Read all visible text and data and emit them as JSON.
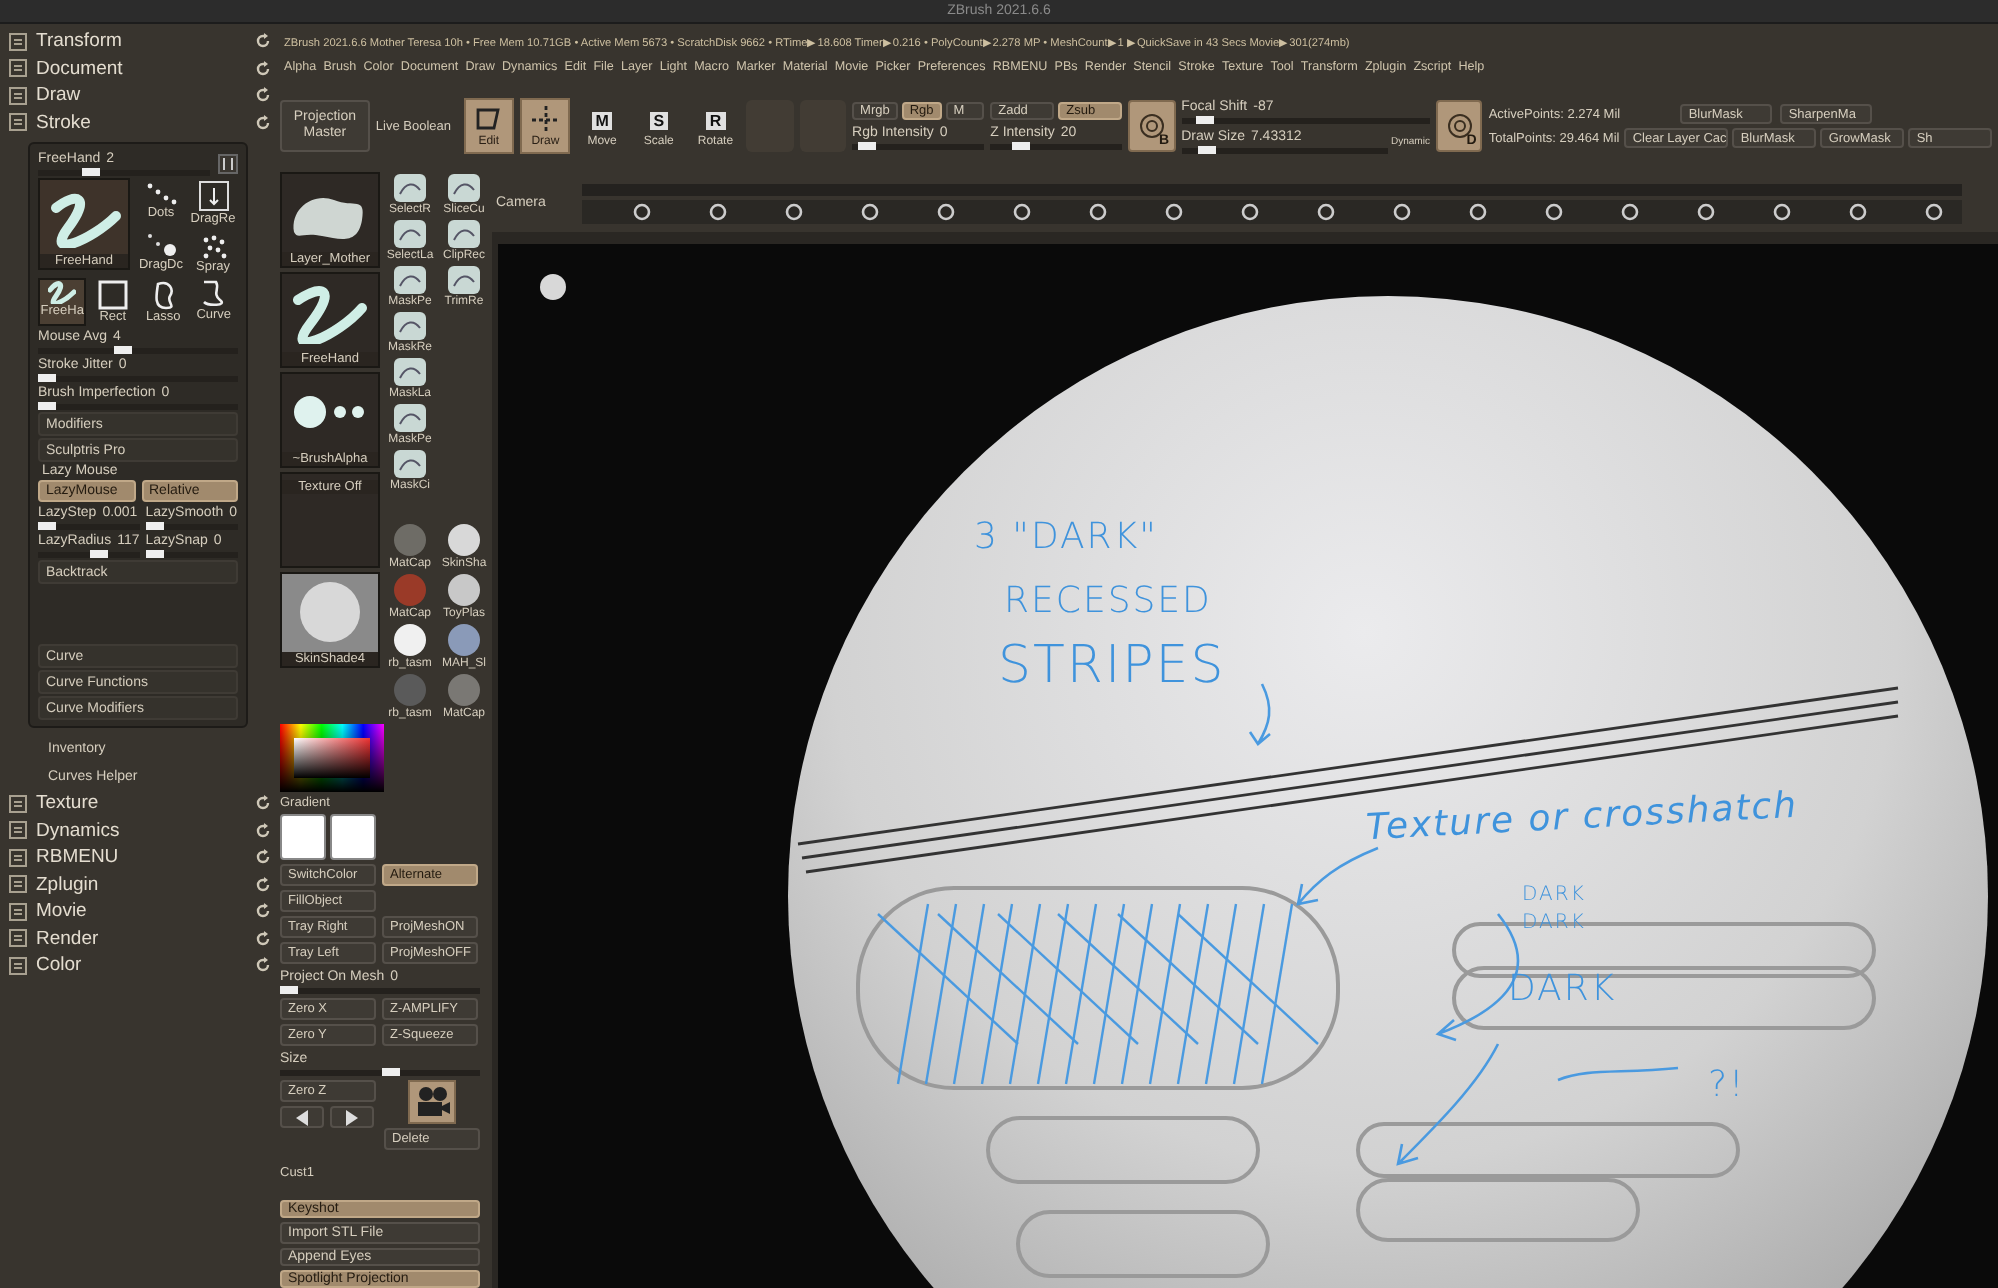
{
  "title": "ZBrush 2021.6.6",
  "info_line": "ZBrush 2021.6.6 Mother Teresa 10h  • Free Mem 10.71GB • Active Mem 5673 • ScratchDisk 9662 • RTime▶18.608 Timer▶0.216 • PolyCount▶2.278 MP • MeshCount▶1  ▶QuickSave in 43 Secs Movie▶301(274mb)",
  "menu": [
    "Alpha",
    "Brush",
    "Color",
    "Document",
    "Draw",
    "Dynamics",
    "Edit",
    "File",
    "Layer",
    "Light",
    "Macro",
    "Marker",
    "Material",
    "Movie",
    "Picker",
    "Preferences",
    "RBMENU",
    "PBs",
    "Render",
    "Stencil",
    "Stroke",
    "Texture",
    "Tool",
    "Transform",
    "Zplugin",
    "Zscript",
    "Help"
  ],
  "palettes_top": [
    "Transform",
    "Document",
    "Draw",
    "Stroke"
  ],
  "stroke_panel": {
    "preset": {
      "label": "FreeHand",
      "value": "2",
      "level": 0.3
    },
    "main_thumb": {
      "label": "FreeHand"
    },
    "types": [
      {
        "label": "Dots",
        "kind": "dots",
        "selected": false
      },
      {
        "label": "DragRe",
        "kind": "drag-rect",
        "selected": false
      },
      {
        "label": "DragDc",
        "kind": "drag-dot",
        "selected": false
      },
      {
        "label": "Spray",
        "kind": "spray",
        "selected": false
      }
    ],
    "modes": [
      {
        "label": "FreeHa",
        "kind": "freehand",
        "selected": true
      },
      {
        "label": "Rect",
        "kind": "rect",
        "selected": false
      },
      {
        "label": "Lasso",
        "kind": "lasso",
        "selected": false
      },
      {
        "label": "Curve",
        "kind": "curve",
        "selected": false
      }
    ],
    "sliders": [
      {
        "label": "Mouse Avg",
        "value": "4",
        "level": 0.45
      },
      {
        "label": "Stroke Jitter",
        "value": "0",
        "level": 0.0
      },
      {
        "label": "Brush Imperfection",
        "value": "0",
        "level": 0.0
      }
    ],
    "buttons": [
      "Modifiers",
      "Sculptris Pro"
    ],
    "lazy_header": "Lazy Mouse",
    "lazy_toggles": [
      {
        "label": "LazyMouse",
        "on": true
      },
      {
        "label": "Relative",
        "on": true
      }
    ],
    "lazy_sliders": [
      {
        "label": "LazyStep",
        "value": "0.001",
        "level": 0.0
      },
      {
        "label": "LazySmooth",
        "value": "0",
        "level": 0.0
      },
      {
        "label": "LazyRadius",
        "value": "117",
        "level": 0.6
      },
      {
        "label": "LazySnap",
        "value": "0",
        "level": 0.0
      }
    ],
    "backtrack": "Backtrack",
    "curve_buttons": [
      "Curve",
      "Curve Functions",
      "Curve Modifiers"
    ]
  },
  "sub_items": [
    "Inventory",
    "Curves Helper"
  ],
  "palettes_bottom": [
    "Texture",
    "Dynamics",
    "RBMENU",
    "Zplugin",
    "Movie",
    "Render",
    "Color"
  ],
  "toolbar": {
    "projection_master": "Projection Master",
    "live_boolean": "Live Boolean",
    "modes": [
      {
        "label": "Edit",
        "on": true
      },
      {
        "label": "Draw",
        "on": true
      },
      {
        "label": "Move",
        "key": "M",
        "on": false
      },
      {
        "label": "Scale",
        "key": "S",
        "on": false
      },
      {
        "label": "Rotate",
        "key": "R",
        "on": false
      }
    ],
    "rgb": [
      {
        "label": "Mrgb",
        "on": false
      },
      {
        "label": "Rgb",
        "on": true
      },
      {
        "label": "M",
        "on": false
      }
    ],
    "rgb_intensity": {
      "label": "Rgb Intensity",
      "value": "0",
      "level": 0.05
    },
    "z": [
      {
        "label": "Zadd",
        "on": false
      },
      {
        "label": "Zsub",
        "on": true
      }
    ],
    "z_intensity": {
      "label": "Z Intensity",
      "value": "20",
      "level": 0.2
    },
    "brush_badges": [
      "B",
      "D"
    ],
    "focal_shift": {
      "label": "Focal Shift",
      "value": "-87",
      "level": 0.07
    },
    "draw_size": {
      "label": "Draw Size",
      "value": "7.43312",
      "level": 0.1
    },
    "dynamic": "Dynamic",
    "stats": [
      "ActivePoints: 2.274 Mil",
      "TotalPoints: 29.464 Mil"
    ],
    "mask_buttons_top": [
      "BlurMask",
      "SharpenMa"
    ],
    "mask_buttons_bottom": [
      "Clear Layer Cac",
      "BlurMask",
      "GrowMask",
      "Sh"
    ]
  },
  "timeline": {
    "label": "Camera"
  },
  "tool_column": {
    "thumbs": [
      {
        "label": "Layer_Mother",
        "kind": "mesh"
      },
      {
        "label": "FreeHand",
        "kind": "stroke"
      },
      {
        "label": "~BrushAlpha",
        "kind": "alpha"
      },
      {
        "label": "Texture Off",
        "kind": "empty"
      },
      {
        "label": "SkinShade4",
        "kind": "material"
      }
    ],
    "brush_rows": [
      [
        "SelectR",
        "SliceCu"
      ],
      [
        "SelectLa",
        "ClipRec"
      ],
      [
        "MaskPe",
        "TrimRe"
      ],
      [
        "MaskRe"
      ],
      [
        "MaskLa"
      ],
      [
        "MaskPe"
      ],
      [
        "MaskCi"
      ]
    ],
    "materials": [
      {
        "label": "MatCap",
        "color": "#6e6c66"
      },
      {
        "label": "SkinSha",
        "color": "#d8d8d8"
      },
      {
        "label": "MatCap",
        "color": "#9a3a28"
      },
      {
        "label": "ToyPlas",
        "color": "#c8c8c8"
      },
      {
        "label": "rb_tasm",
        "color": "#f0f0f0"
      },
      {
        "label": "MAH_Sl",
        "color": "#8a9ab8"
      },
      {
        "label": "rb_tasm",
        "color": "#5a5a5a"
      },
      {
        "label": "MatCap",
        "color": "#7a7874"
      }
    ],
    "gradient": "Gradient",
    "button_rows": [
      [
        {
          "label": "SwitchColor",
          "on": false
        },
        {
          "label": "Alternate",
          "on": true
        }
      ],
      [
        {
          "label": "FillObject",
          "on": false
        }
      ],
      [
        {
          "label": "Tray Right",
          "on": false
        },
        {
          "label": "ProjMeshON",
          "on": false
        }
      ],
      [
        {
          "label": "Tray Left",
          "on": false
        },
        {
          "label": "ProjMeshOFF",
          "on": false
        }
      ]
    ],
    "project_slider": {
      "label": "Project On Mesh",
      "value": "0",
      "level": 0.0
    },
    "zero_rows": [
      [
        "Zero X",
        "Z-AMPLIFY"
      ],
      [
        "Zero Y",
        "Z-Squeeze"
      ]
    ],
    "size_slider": {
      "label": "Size",
      "level": 0.6
    },
    "zero_z": "Zero Z",
    "delete": "Delete",
    "cust": "Cust1",
    "big_buttons": [
      {
        "label": "Keyshot",
        "on": true
      },
      {
        "label": "Import STL File",
        "on": false
      },
      {
        "label": "Append Eyes",
        "on": false
      },
      {
        "label": "Spotlight Projection",
        "on": true
      }
    ]
  },
  "canvas": {
    "notes": [
      {
        "text": "3 \"DARK\"",
        "kind": "large"
      },
      {
        "text": "RECESSED",
        "kind": "large"
      },
      {
        "text": "STRIPES",
        "kind": "huge"
      },
      {
        "text": "Texture or crosshatch",
        "kind": "script"
      },
      {
        "text": "DARK",
        "kind": "small"
      },
      {
        "text": "DARK",
        "kind": "small"
      },
      {
        "text": "DARK",
        "kind": "large"
      },
      {
        "text": "?!",
        "kind": "large"
      }
    ]
  }
}
